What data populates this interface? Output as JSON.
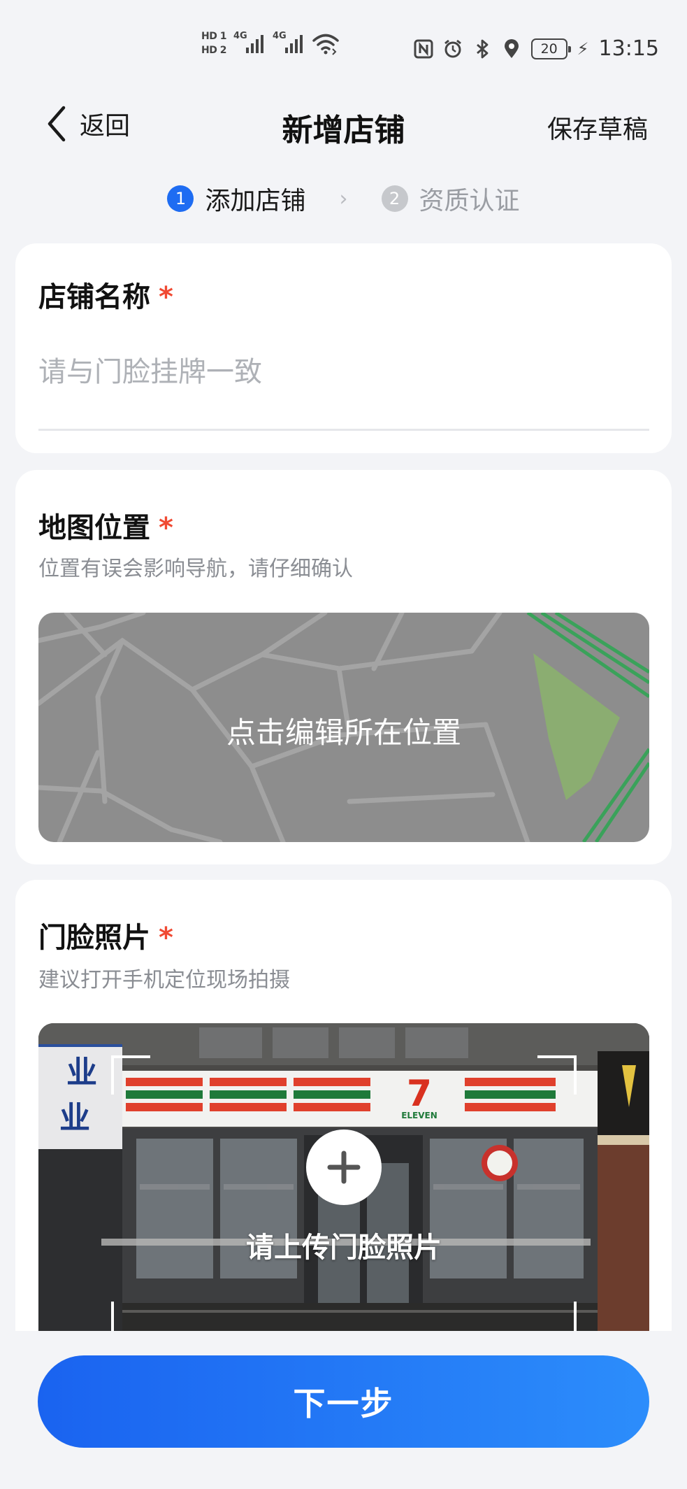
{
  "status_bar": {
    "hd1": "HD 1",
    "hd2": "HD 2",
    "net1": "4G",
    "net2": "4G",
    "battery": "20",
    "time": "13:15",
    "icons": [
      "nfc-icon",
      "alarm-icon",
      "bluetooth-icon",
      "location-icon",
      "charging-icon"
    ]
  },
  "nav": {
    "back_label": "返回",
    "title": "新增店铺",
    "save_draft": "保存草稿"
  },
  "steps": [
    {
      "num": "1",
      "label": "添加店铺",
      "active": true
    },
    {
      "num": "2",
      "label": "资质认证",
      "active": false
    }
  ],
  "store_name": {
    "title": "店铺名称",
    "required_mark": "*",
    "value": "",
    "placeholder": "请与门脸挂牌一致"
  },
  "map": {
    "title": "地图位置",
    "required_mark": "*",
    "subtitle": "位置有误会影响导航，请仔细确认",
    "action_label": "点击编辑所在位置"
  },
  "photo": {
    "title": "门脸照片",
    "required_mark": "*",
    "subtitle": "建议打开手机定位现场拍摄",
    "upload_label": "请上传门脸照片",
    "sign_left_top": "业",
    "sign_left_bottom": "业",
    "store_logo_text": "ELEVEN",
    "store_logo_number": "7"
  },
  "footer": {
    "next_label": "下一步"
  },
  "colors": {
    "primary": "#1e6cf2",
    "required": "#f04a33",
    "page_bg": "#f3f4f7"
  }
}
